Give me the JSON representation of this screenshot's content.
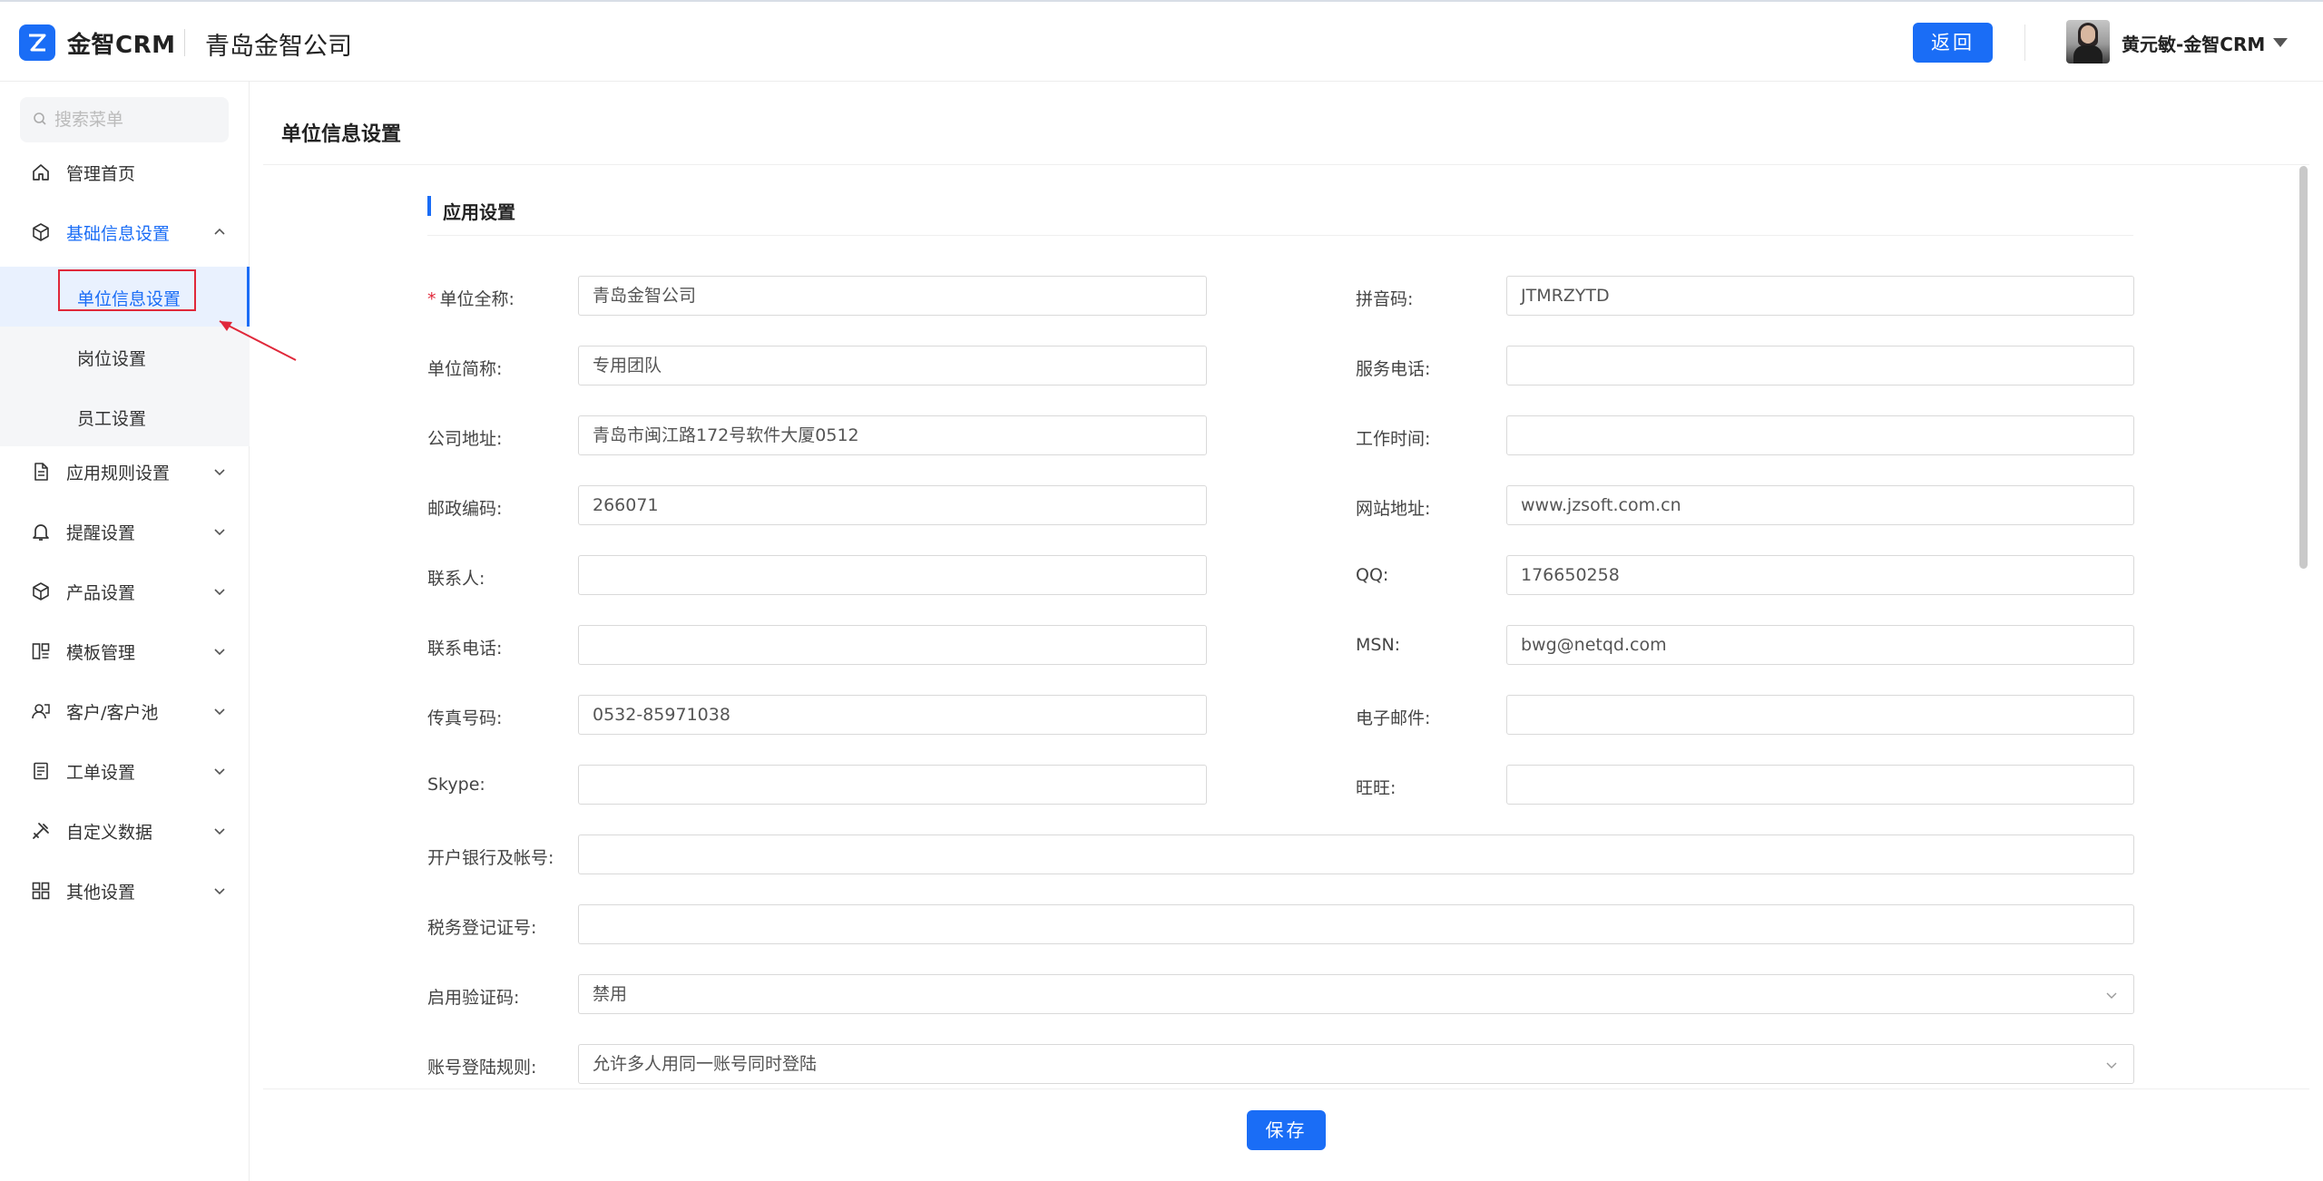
{
  "header": {
    "brand": "金智CRM",
    "company": "青岛金智公司",
    "back_label": "返回",
    "user_name": "黄元敏-金智CRM",
    "brand_color": "#1a6df6"
  },
  "sidebar": {
    "search_placeholder": "搜索菜单",
    "items": [
      {
        "label": "管理首页",
        "icon": "home-icon"
      },
      {
        "label": "基础信息设置",
        "icon": "cube-icon",
        "open": true,
        "children": [
          {
            "label": "单位信息设置",
            "active": true
          },
          {
            "label": "岗位设置"
          },
          {
            "label": "员工设置"
          }
        ]
      },
      {
        "label": "应用规则设置",
        "icon": "document-icon"
      },
      {
        "label": "提醒设置",
        "icon": "bell-icon"
      },
      {
        "label": "产品设置",
        "icon": "cube-icon"
      },
      {
        "label": "模板管理",
        "icon": "template-icon"
      },
      {
        "label": "客户/客户池",
        "icon": "customer-icon"
      },
      {
        "label": "工单设置",
        "icon": "ticket-icon"
      },
      {
        "label": "自定义数据",
        "icon": "tools-icon"
      },
      {
        "label": "其他设置",
        "icon": "grid-icon"
      }
    ]
  },
  "main": {
    "title": "单位信息设置",
    "section_title": "应用设置",
    "fields": {
      "unit_full_name": {
        "label": "单位全称:",
        "value": "青岛金智公司",
        "required": true
      },
      "pinyin": {
        "label": "拼音码:",
        "value": "JTMRZYTD"
      },
      "unit_short_name": {
        "label": "单位简称:",
        "value": "专用团队"
      },
      "service_phone": {
        "label": "服务电话:",
        "value": ""
      },
      "address": {
        "label": "公司地址:",
        "value": "青岛市闽江路172号软件大厦0512"
      },
      "work_time": {
        "label": "工作时间:",
        "value": ""
      },
      "postcode": {
        "label": "邮政编码:",
        "value": "266071"
      },
      "website": {
        "label": "网站地址:",
        "value": "www.jzsoft.com.cn"
      },
      "contact": {
        "label": "联系人:",
        "value": ""
      },
      "qq": {
        "label": "QQ:",
        "value": "176650258"
      },
      "contact_phone": {
        "label": "联系电话:",
        "value": ""
      },
      "msn": {
        "label": "MSN:",
        "value": "bwg@netqd.com"
      },
      "fax": {
        "label": "传真号码:",
        "value": "0532-85971038"
      },
      "email": {
        "label": "电子邮件:",
        "value": ""
      },
      "skype": {
        "label": "Skype:",
        "value": ""
      },
      "wangwang": {
        "label": "旺旺:",
        "value": ""
      },
      "bank": {
        "label": "开户银行及帐号:",
        "value": ""
      },
      "tax": {
        "label": "税务登记证号:",
        "value": ""
      },
      "captcha": {
        "label": "启用验证码:",
        "value": "禁用"
      },
      "login_rule": {
        "label": "账号登陆规则:",
        "value": "允许多人用同一账号同时登陆"
      }
    },
    "save_label": "保存"
  }
}
